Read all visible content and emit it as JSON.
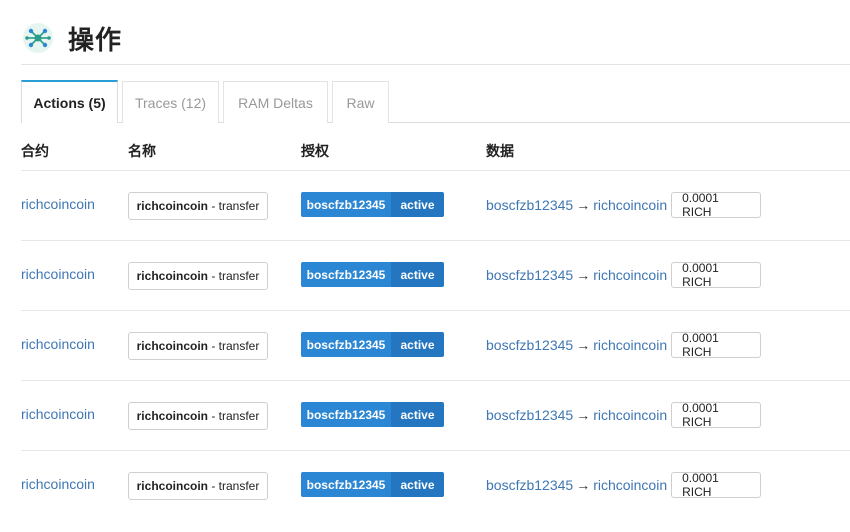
{
  "header": {
    "title": "操作",
    "icon": "network-hub-icon"
  },
  "tabs": [
    {
      "label": "Actions (5)",
      "active": true
    },
    {
      "label": "Traces (12)",
      "active": false
    },
    {
      "label": "RAM Deltas",
      "active": false
    },
    {
      "label": "Raw",
      "active": false
    }
  ],
  "columns": {
    "contract": "合约",
    "name": "名称",
    "auth": "授权",
    "data": "数据"
  },
  "rows": [
    {
      "contract": "richcoincoin",
      "name_account": "richcoincoin",
      "name_sep": " - ",
      "name_action": "transfer",
      "actor": "boscfzb12345",
      "permission": "active",
      "from": "boscfzb12345",
      "arrow": "→",
      "to": "richcoincoin",
      "amount": "0.0001 RICH"
    },
    {
      "contract": "richcoincoin",
      "name_account": "richcoincoin",
      "name_sep": " - ",
      "name_action": "transfer",
      "actor": "boscfzb12345",
      "permission": "active",
      "from": "boscfzb12345",
      "arrow": "→",
      "to": "richcoincoin",
      "amount": "0.0001 RICH"
    },
    {
      "contract": "richcoincoin",
      "name_account": "richcoincoin",
      "name_sep": " - ",
      "name_action": "transfer",
      "actor": "boscfzb12345",
      "permission": "active",
      "from": "boscfzb12345",
      "arrow": "→",
      "to": "richcoincoin",
      "amount": "0.0001 RICH"
    },
    {
      "contract": "richcoincoin",
      "name_account": "richcoincoin",
      "name_sep": " - ",
      "name_action": "transfer",
      "actor": "boscfzb12345",
      "permission": "active",
      "from": "boscfzb12345",
      "arrow": "→",
      "to": "richcoincoin",
      "amount": "0.0001 RICH"
    },
    {
      "contract": "richcoincoin",
      "name_account": "richcoincoin",
      "name_sep": " - ",
      "name_action": "transfer",
      "actor": "boscfzb12345",
      "permission": "active",
      "from": "boscfzb12345",
      "arrow": "→",
      "to": "richcoincoin",
      "amount": "0.0001 RICH"
    }
  ],
  "colors": {
    "link": "#3f77b4",
    "tab_accent": "#2b9ed8",
    "auth_actor": "#2b87d3",
    "auth_perm": "#2476c1"
  }
}
